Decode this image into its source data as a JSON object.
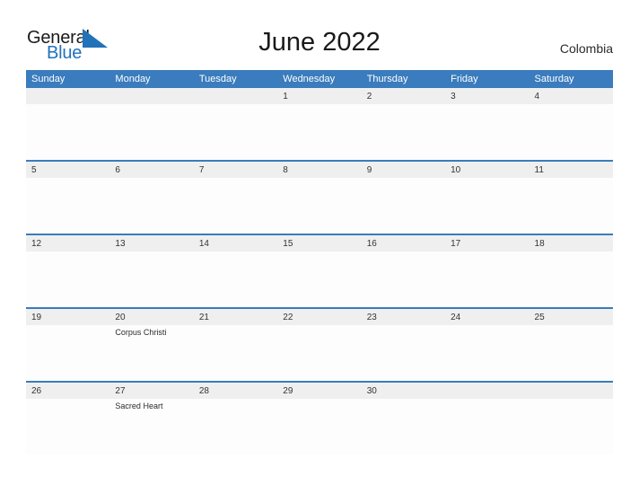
{
  "brand": {
    "name_part1": "General",
    "name_part2": "Blue",
    "mark": "blue-triangle-flag-icon",
    "color_dark": "#1a1a1a",
    "color_blue": "#2272b9"
  },
  "header": {
    "title": "June 2022",
    "country": "Colombia"
  },
  "theme": {
    "header_blue": "#3a7cbd",
    "band_gray": "#efefef",
    "cell_white": "#fdfdfd",
    "text_dark": "#333333"
  },
  "calendar": {
    "month": "June",
    "year": "2022",
    "weekday_headers": [
      "Sunday",
      "Monday",
      "Tuesday",
      "Wednesday",
      "Thursday",
      "Friday",
      "Saturday"
    ],
    "weeks": [
      [
        {
          "day": "",
          "events": []
        },
        {
          "day": "",
          "events": []
        },
        {
          "day": "",
          "events": []
        },
        {
          "day": "1",
          "events": []
        },
        {
          "day": "2",
          "events": []
        },
        {
          "day": "3",
          "events": []
        },
        {
          "day": "4",
          "events": []
        }
      ],
      [
        {
          "day": "5",
          "events": []
        },
        {
          "day": "6",
          "events": []
        },
        {
          "day": "7",
          "events": []
        },
        {
          "day": "8",
          "events": []
        },
        {
          "day": "9",
          "events": []
        },
        {
          "day": "10",
          "events": []
        },
        {
          "day": "11",
          "events": []
        }
      ],
      [
        {
          "day": "12",
          "events": []
        },
        {
          "day": "13",
          "events": []
        },
        {
          "day": "14",
          "events": []
        },
        {
          "day": "15",
          "events": []
        },
        {
          "day": "16",
          "events": []
        },
        {
          "day": "17",
          "events": []
        },
        {
          "day": "18",
          "events": []
        }
      ],
      [
        {
          "day": "19",
          "events": []
        },
        {
          "day": "20",
          "events": [
            "Corpus Christi"
          ]
        },
        {
          "day": "21",
          "events": []
        },
        {
          "day": "22",
          "events": []
        },
        {
          "day": "23",
          "events": []
        },
        {
          "day": "24",
          "events": []
        },
        {
          "day": "25",
          "events": []
        }
      ],
      [
        {
          "day": "26",
          "events": []
        },
        {
          "day": "27",
          "events": [
            "Sacred Heart"
          ]
        },
        {
          "day": "28",
          "events": []
        },
        {
          "day": "29",
          "events": []
        },
        {
          "day": "30",
          "events": []
        },
        {
          "day": "",
          "events": []
        },
        {
          "day": "",
          "events": []
        }
      ]
    ]
  }
}
